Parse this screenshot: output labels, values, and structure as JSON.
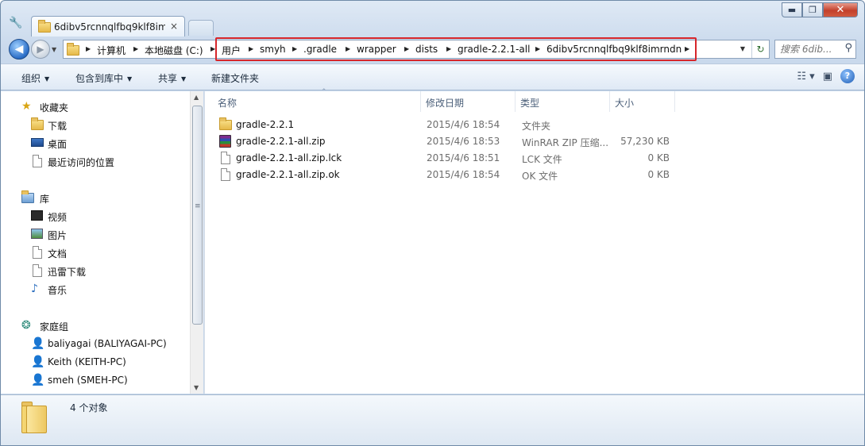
{
  "window": {
    "tab_title": "6dibv5rcnnqlfbq9klf8im",
    "tab_close": "×",
    "controls": {
      "minimize": "▬",
      "maximize": "❐",
      "close": "✕"
    }
  },
  "address": {
    "crumbs": [
      "计算机",
      "本地磁盘 (C:)",
      "用户",
      "smyh",
      ".gradle",
      "wrapper",
      "dists",
      "gradle-2.2.1-all",
      "6dibv5rcnnqlfbq9klf8imrndn"
    ],
    "highlight_color": "#d6262b"
  },
  "search": {
    "placeholder": "搜索 6dib..."
  },
  "commands": {
    "organize": "组织",
    "include_in_library": "包含到库中",
    "share": "共享",
    "new_folder": "新建文件夹"
  },
  "nav": {
    "favorites": {
      "header": "收藏夹",
      "items": [
        "下载",
        "桌面",
        "最近访问的位置"
      ]
    },
    "libraries": {
      "header": "库",
      "items": [
        "视频",
        "图片",
        "文档",
        "迅雷下载",
        "音乐"
      ]
    },
    "homegroup": {
      "header": "家庭组",
      "items": [
        "baliyagai (BALIYAGAI-PC)",
        "Keith (KEITH-PC)",
        "smeh (SMEH-PC)"
      ]
    }
  },
  "columns": {
    "name": "名称",
    "modified": "修改日期",
    "type": "类型",
    "size": "大小"
  },
  "files": [
    {
      "icon": "folder-icon",
      "name": "gradle-2.2.1",
      "modified": "2015/4/6 18:54",
      "type": "文件夹",
      "size": ""
    },
    {
      "icon": "winrar-archive-icon",
      "name": "gradle-2.2.1-all.zip",
      "modified": "2015/4/6 18:53",
      "type": "WinRAR ZIP 压缩...",
      "size": "57,230 KB"
    },
    {
      "icon": "document-icon",
      "name": "gradle-2.2.1-all.zip.lck",
      "modified": "2015/4/6 18:51",
      "type": "LCK 文件",
      "size": "0 KB"
    },
    {
      "icon": "document-icon",
      "name": "gradle-2.2.1-all.zip.ok",
      "modified": "2015/4/6 18:54",
      "type": "OK 文件",
      "size": "0 KB"
    }
  ],
  "status": {
    "count": "4 个对象"
  }
}
